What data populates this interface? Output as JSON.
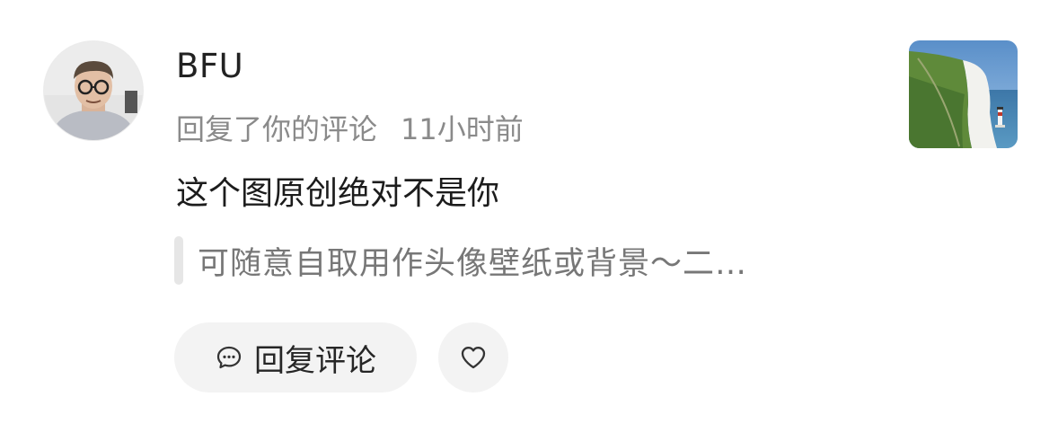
{
  "notification": {
    "user": {
      "name": "BFU",
      "avatar_icon": "user-avatar"
    },
    "action_text": "回复了你的评论",
    "time_text": "11小时前",
    "comment_text": "这个图原创绝对不是你",
    "quoted_text": "可随意自取用作头像壁纸或背景～二…",
    "thumbnail_icon": "cliff-lighthouse-thumbnail"
  },
  "actions": {
    "reply_label": "回复评论",
    "reply_icon": "comment-bubble-icon",
    "like_icon": "heart-icon"
  }
}
